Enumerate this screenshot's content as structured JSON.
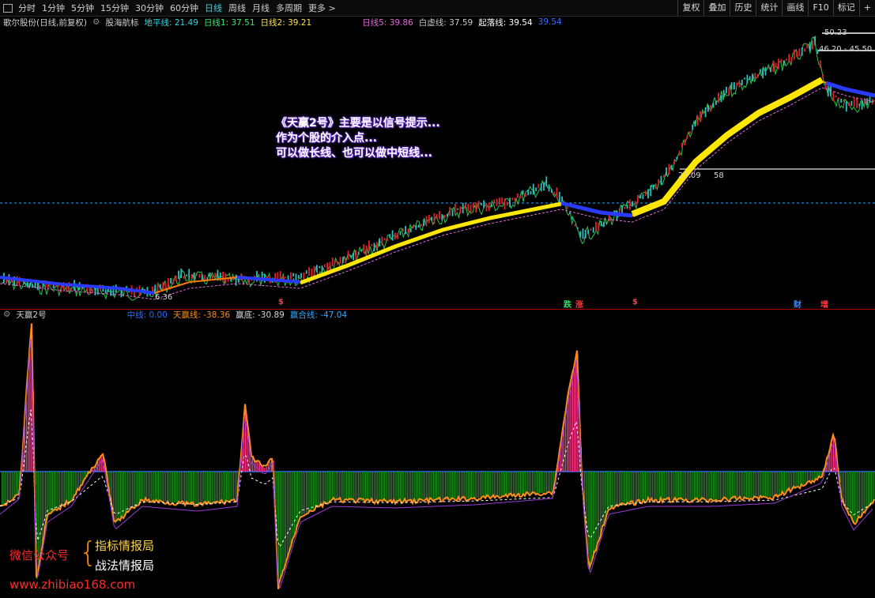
{
  "toolbar": {
    "periods": [
      "分时",
      "1分钟",
      "5分钟",
      "15分钟",
      "30分钟",
      "60分钟",
      "日线",
      "周线",
      "月线",
      "多周期",
      "更多 >"
    ],
    "active_period": "日线",
    "right_buttons": [
      "复权",
      "叠加",
      "历史",
      "统计",
      "画线",
      "F10",
      "标记",
      "+"
    ]
  },
  "main_legend": {
    "stock": "歌尔股份(日线,前复权)",
    "indicator": "股海航标",
    "items": [
      {
        "label": "地平线: 21.49",
        "color": "#2fd7e8"
      },
      {
        "label": "日线1: 37.51",
        "color": "#3ee66a"
      },
      {
        "label": "日线2: 39.21",
        "color": "#ffe14a"
      },
      {
        "label": "日线5: 39.86",
        "color": "#e06ad8"
      },
      {
        "label": "白虚线: 37.59",
        "color": "#c8c8c8"
      },
      {
        "label": "起落线: 39.54",
        "color": "#ffffff"
      },
      {
        "label": "39.54",
        "color": "#3b6bff"
      }
    ]
  },
  "sub_legend": {
    "indicator": "天赢2号",
    "items": [
      {
        "label": "中线: 0.00",
        "color": "#2a6bff"
      },
      {
        "label": "天赢线: -38.36",
        "color": "#ff8c1a"
      },
      {
        "label": "赢底: -30.89",
        "color": "#d8d8d8"
      },
      {
        "label": "赢合线: -47.04",
        "color": "#2fa8ff"
      }
    ]
  },
  "note": {
    "line1": "《天赢2号》主要是以信号提示...",
    "line2": "作为个股的介入点...",
    "line3": "可以做长线、也可以做中短线..."
  },
  "price_labels": {
    "high": "50.23",
    "range": "46.20 - 45.50",
    "mid": "27.09",
    "mid2": "58",
    "low": "6.36"
  },
  "events": [
    {
      "text": "跌",
      "color": "#2fe06a"
    },
    {
      "text": "涨",
      "color": "#ff3a3a"
    },
    {
      "text": "财",
      "color": "#3b8bff"
    },
    {
      "text": "增",
      "color": "#ff3a3a"
    },
    {
      "text": "$",
      "color": "#ff3a3a"
    },
    {
      "text": "$",
      "color": "#ff3a3a"
    }
  ],
  "watermark": {
    "label": "微信公众号",
    "brace": "{",
    "line1": "指标情报局",
    "line2": "战法情报局",
    "url": "www.zhibiao168.com"
  }
}
